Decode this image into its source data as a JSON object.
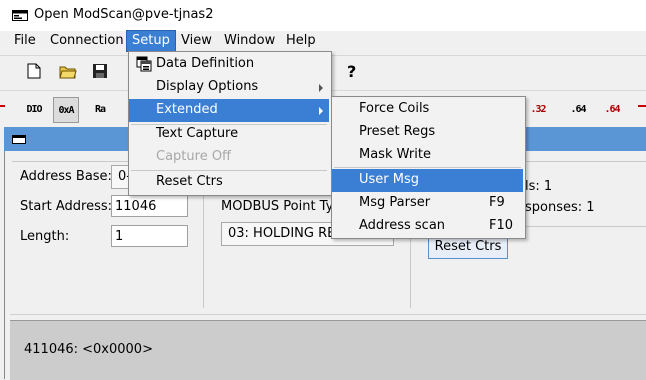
{
  "window": {
    "title": "Open ModScan@pve-tjnas2"
  },
  "menubar": {
    "file": "File",
    "connection": "Connection",
    "setup": "Setup",
    "view": "View",
    "window": "Window",
    "help": "Help"
  },
  "toolbar2": {
    "b1": "DIO",
    "b2": "0xA",
    "b3": "Ra",
    "b4": ".32",
    "b5": ".64",
    "b6": ".64"
  },
  "setup_menu": {
    "items": [
      {
        "label": "Data Definition"
      },
      {
        "label": "Display Options"
      },
      {
        "label": "Extended"
      },
      {
        "label": "Text Capture"
      },
      {
        "label": "Capture Off"
      },
      {
        "label": "Reset Ctrs"
      }
    ]
  },
  "extended_menu": {
    "items": [
      {
        "label": "Force Coils",
        "shortcut": ""
      },
      {
        "label": "Preset Regs",
        "shortcut": ""
      },
      {
        "label": "Mask Write",
        "shortcut": ""
      },
      {
        "label": "User Msg",
        "shortcut": ""
      },
      {
        "label": "Msg Parser",
        "shortcut": "F9"
      },
      {
        "label": "Address scan",
        "shortcut": "F10"
      }
    ]
  },
  "form": {
    "address_base_label": "Address Base:",
    "address_base_value": "0-",
    "start_address_label": "Start Address:",
    "start_address_value": "11046",
    "length_label": "Length:",
    "length_value": "1",
    "modbus_point_type_label": "MODBUS Point Typ",
    "modbus_point_type_value": "03: HOLDING REGISTER",
    "polls_text": "ls: 1",
    "responses_text": "sponses: 1",
    "reset_ctrs_button": "Reset Ctrs"
  },
  "data_area": {
    "line1": "411046: <0x0000>"
  },
  "colors": {
    "highlight": "#3b7fd4",
    "child_title": "#5a96d6"
  }
}
